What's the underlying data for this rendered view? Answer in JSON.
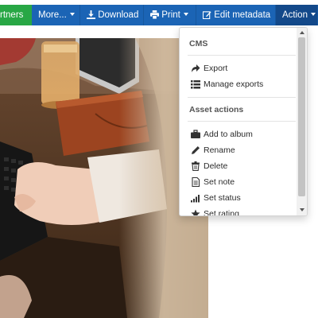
{
  "toolbar": {
    "partners_label": "rtners",
    "more_label": "More...",
    "download_label": "Download",
    "print_label": "Print",
    "edit_metadata_label": "Edit metadata",
    "action_label": "Action"
  },
  "dropdown": {
    "cms_header": "CMS",
    "cms_items": [
      {
        "label": "Export",
        "icon": "share-icon"
      },
      {
        "label": "Manage exports",
        "icon": "list-icon"
      }
    ],
    "asset_header": "Asset actions",
    "asset_items": [
      {
        "label": "Add to album",
        "icon": "briefcase-icon"
      },
      {
        "label": "Rename",
        "icon": "pencil-icon"
      },
      {
        "label": "Delete",
        "icon": "trash-icon"
      },
      {
        "label": "Set note",
        "icon": "note-icon"
      },
      {
        "label": "Set status",
        "icon": "signal-icon"
      },
      {
        "label": "Set rating",
        "icon": "star-icon"
      }
    ]
  },
  "colors": {
    "green_button": "#28a745",
    "blue_button": "#1b64b5",
    "active_button": "#13498a"
  }
}
